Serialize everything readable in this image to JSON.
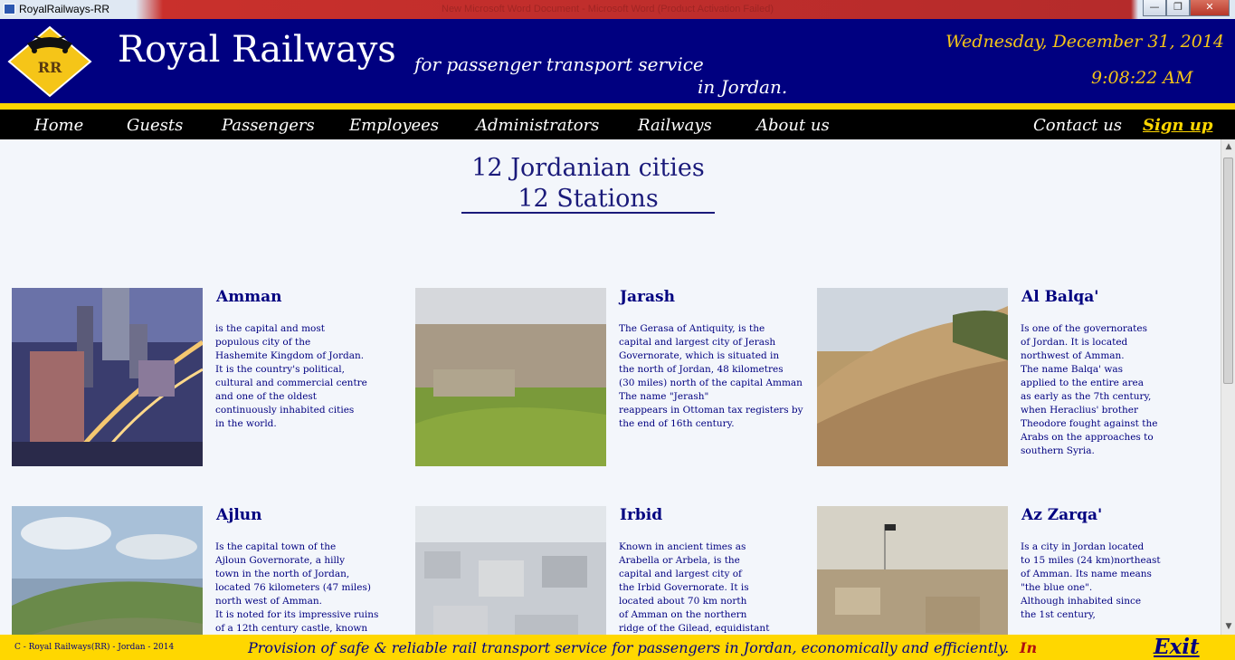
{
  "window": {
    "title": "RoyalRailways-RR",
    "ghost_title": "New Microsoft Word Document - Microsoft Word (Product Activation Failed)",
    "minimize": "—",
    "maximize": "❐",
    "close": "✕"
  },
  "header": {
    "logo_text": "RR",
    "brand": "Royal Railways",
    "tagline_line1": "for passenger transport service",
    "tagline_line2": "in Jordan.",
    "date": "Wednesday, December 31, 2014",
    "time": "9:08:22 AM"
  },
  "nav": {
    "items": [
      "Home",
      "Guests",
      "Passengers",
      "Employees",
      "Administrators",
      "Railways",
      "About us"
    ],
    "contact": "Contact us",
    "signup": "Sign up"
  },
  "main": {
    "heading_line1": "12 Jordanian cities",
    "heading_line2": "12 Stations",
    "cities": [
      {
        "name": "Amman",
        "description": "is the capital and most\npopulous city of the\nHashemite Kingdom of Jordan.\nIt is the country's political,\ncultural and commercial centre\nand one of the oldest\ncontinuously inhabited cities\nin the world."
      },
      {
        "name": "Jarash",
        "description": "The Gerasa of Antiquity, is the\ncapital and largest city of Jerash\nGovernorate, which is situated in\nthe north of Jordan, 48 kilometres\n(30 miles) north of the capital Amman\nThe name \"Jerash\"\nreappears in Ottoman tax registers by\nthe end of 16th century."
      },
      {
        "name": "Al Balqa'",
        "description": "Is one of the governorates\nof Jordan. It is located\nnorthwest of Amman.\nThe name Balqa' was\napplied to the entire area\nas early as the 7th century,\nwhen Heraclius' brother\nTheodore fought against the\nArabs on the approaches to\nsouthern Syria."
      },
      {
        "name": "Ajlun",
        "description": "Is the capital town of the\nAjloun Governorate, a hilly\ntown in the north of Jordan,\nlocated 76 kilometers (47 miles)\nnorth west of Amman.\nIt is noted for its impressive ruins\nof a 12th century castle, known"
      },
      {
        "name": "Irbid",
        "description": "Known in ancient times as\nArabella or Arbela, is the\ncapital and largest city of\n the Irbid Governorate. It is\nlocated about 70 km north\nof Amman on the northern\nridge of the Gilead, equidistant"
      },
      {
        "name": "Az Zarqa'",
        "description": "Is a city in Jordan located\nto 15 miles (24 km)northeast\nof Amman. Its name means\n\"the blue one\".\nAlthough inhabited since\nthe 1st century,"
      }
    ]
  },
  "scrollbar": {
    "up": "▲",
    "down": "▼"
  },
  "footer": {
    "copyright": "C - Royal Railways(RR) - Jordan - 2014",
    "mission": "Provision of safe & reliable rail transport service for passengers in Jordan, economically and efficiently.",
    "in": "In",
    "exit": "Exit"
  },
  "colors": {
    "header_blue": "#000080",
    "gold": "#ffd700",
    "nav_black": "#000000",
    "date_gold": "#f5c518"
  }
}
